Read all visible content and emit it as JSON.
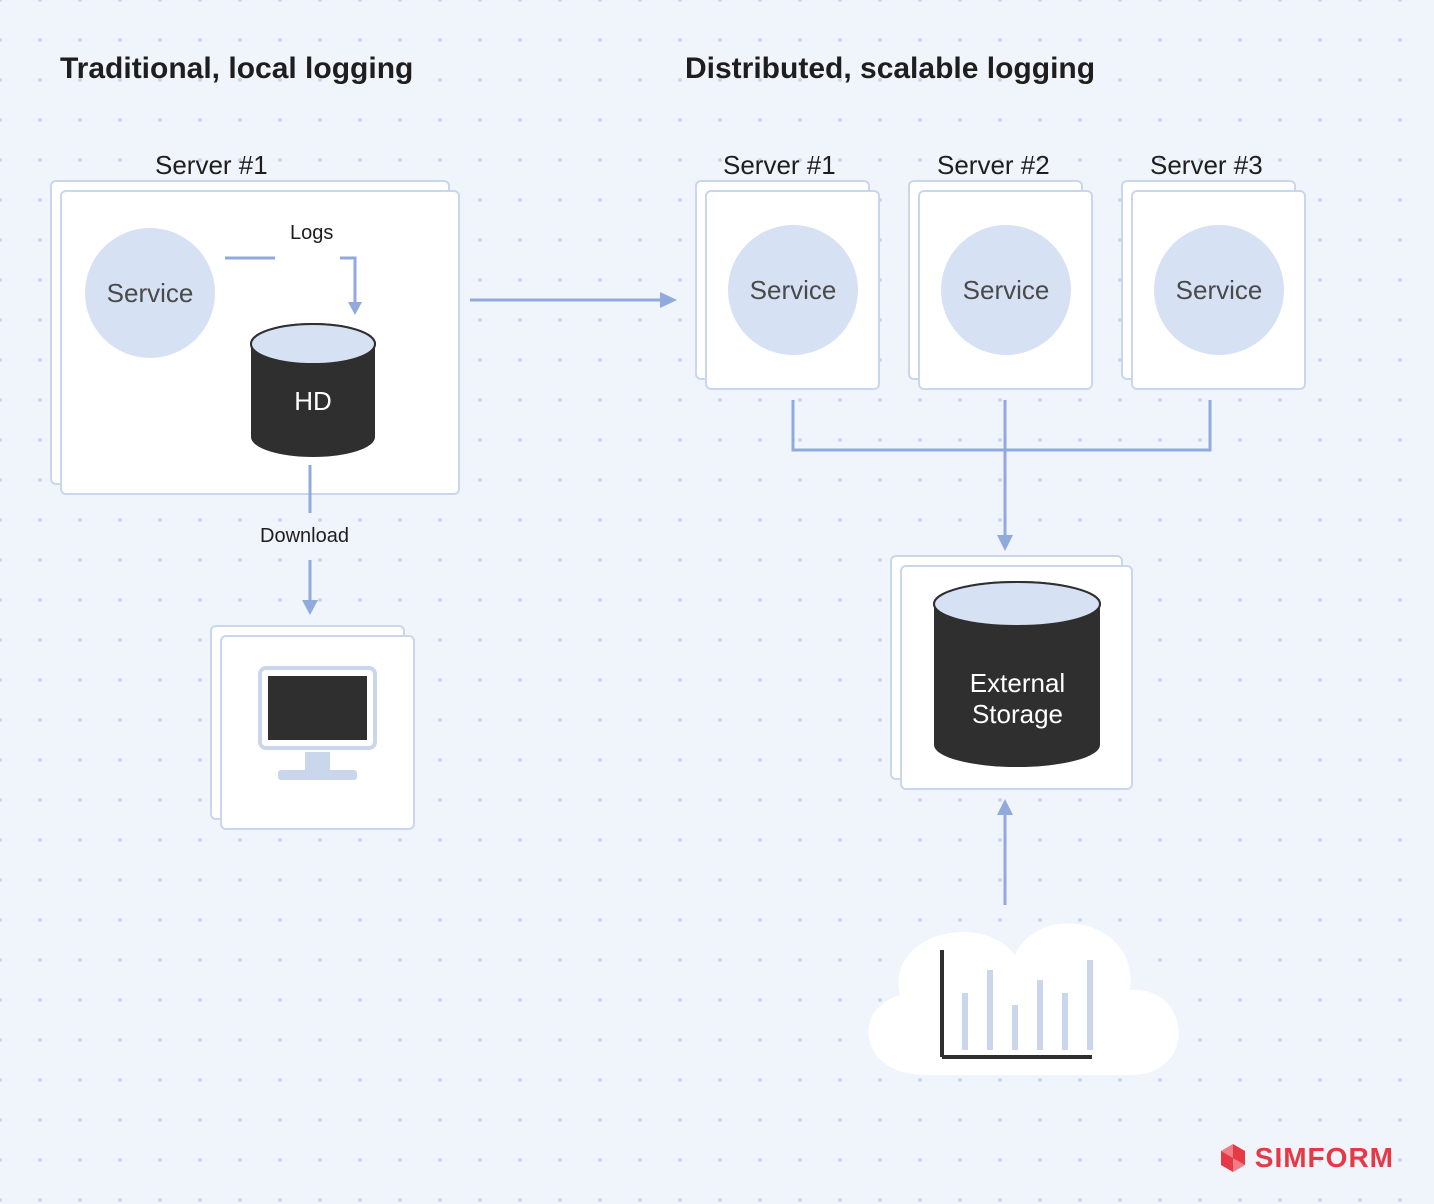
{
  "left": {
    "heading": "Traditional, local logging",
    "server_label": "Server #1",
    "service": "Service",
    "hd": "HD",
    "logs": "Logs",
    "download": "Download"
  },
  "right": {
    "heading": "Distributed, scalable logging",
    "servers": [
      "Server #1",
      "Server #2",
      "Server #3"
    ],
    "service": "Service",
    "external_storage_1": "External",
    "external_storage_2": "Storage"
  },
  "brand": "SIMFORM",
  "colors": {
    "bg": "#f0f4fb",
    "dot": "#c9d6ec",
    "border": "#c9d6ec",
    "circle": "#d6e1f3",
    "arrow": "#90abdb",
    "dark": "#2f2f2f",
    "brand": "#e63946"
  }
}
